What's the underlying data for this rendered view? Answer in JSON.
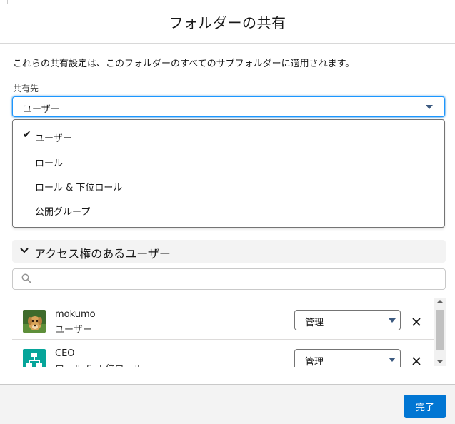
{
  "modal": {
    "title": "フォルダーの共有",
    "info_text": "これらの共有設定は、このフォルダーのすべてのサブフォルダーに適用されます。"
  },
  "share_with": {
    "label": "共有先",
    "selected": "ユーザー",
    "options": [
      {
        "label": "ユーザー",
        "selected": true
      },
      {
        "label": "ロール",
        "selected": false
      },
      {
        "label": "ロール & 下位ロール",
        "selected": false
      },
      {
        "label": "公開グループ",
        "selected": false
      }
    ]
  },
  "access_section": {
    "title": "アクセス権のあるユーザー",
    "search_placeholder": ""
  },
  "entries": [
    {
      "name": "mokumo",
      "type": "ユーザー",
      "access": "管理",
      "avatar": "dog-photo"
    },
    {
      "name": "CEO",
      "type": "ロール & 下位ロール",
      "access": "管理",
      "avatar": "role-hierarchy-icon"
    }
  ],
  "footer": {
    "done_label": "完了"
  },
  "colors": {
    "brand": "#0176d3",
    "focus_border": "#1b96ff",
    "role_icon_bg": "#06a59a",
    "section_bg": "#f3f3f3"
  }
}
